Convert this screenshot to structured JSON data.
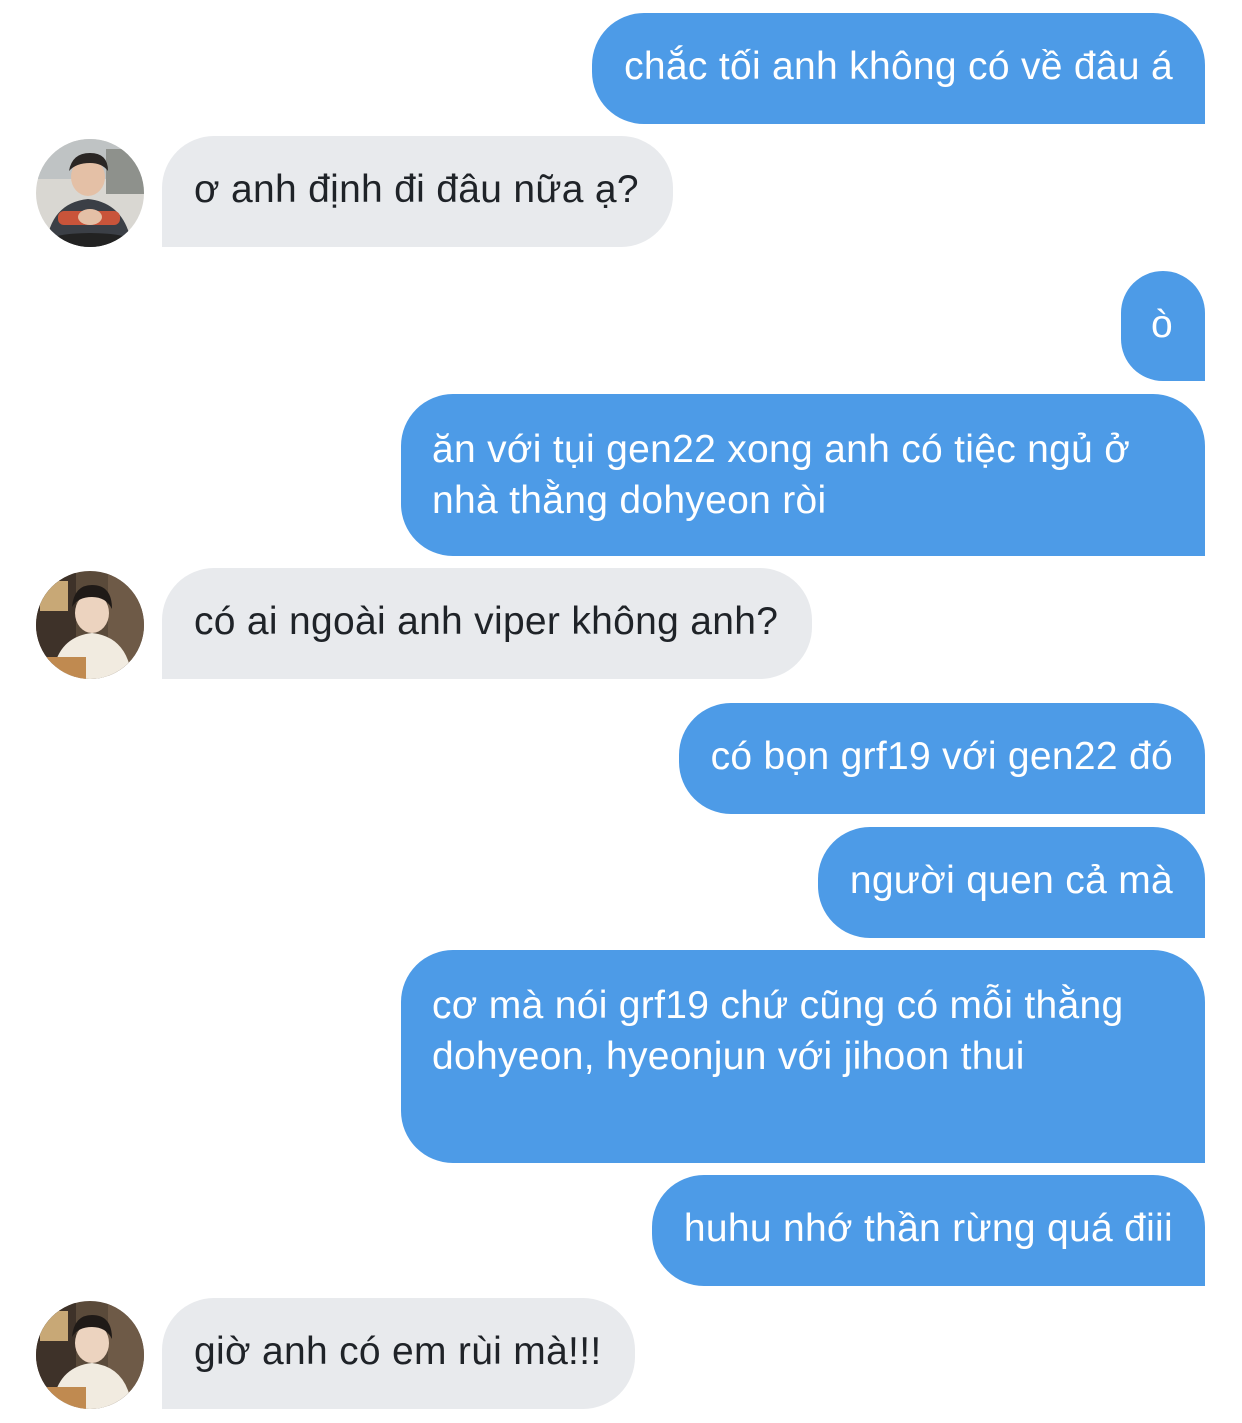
{
  "conversation": {
    "messages": [
      {
        "direction": "outgoing",
        "text": "chắc tối anh không có về đâu á"
      },
      {
        "direction": "incoming",
        "text": "ơ anh định đi đâu nữa ạ?",
        "avatar_icon": "contact-avatar-icon"
      },
      {
        "direction": "outgoing",
        "text": "ò"
      },
      {
        "direction": "outgoing",
        "text": "ăn với tụi gen22 xong anh có tiệc ngủ ở nhà thằng dohyeon ròi"
      },
      {
        "direction": "incoming",
        "text": "có ai ngoài anh viper không anh?",
        "avatar_icon": "contact-avatar-icon"
      },
      {
        "direction": "outgoing",
        "text": "có bọn grf19 với gen22 đó"
      },
      {
        "direction": "outgoing",
        "text": "người quen cả mà"
      },
      {
        "direction": "outgoing",
        "text": "cơ mà nói grf19 chứ cũng có mỗi thằng dohyeon, hyeonjun với jihoon thui"
      },
      {
        "direction": "outgoing",
        "text": "huhu nhớ thần rừng quá điii"
      },
      {
        "direction": "incoming",
        "text": "giờ anh có em rùi mà!!!",
        "avatar_icon": "contact-avatar-icon"
      }
    ]
  },
  "colors": {
    "outgoing_bubble": "#4d9be7",
    "incoming_bubble": "#e8eaed",
    "outgoing_text": "#ffffff",
    "incoming_text": "#1f2328",
    "background": "#ffffff"
  }
}
